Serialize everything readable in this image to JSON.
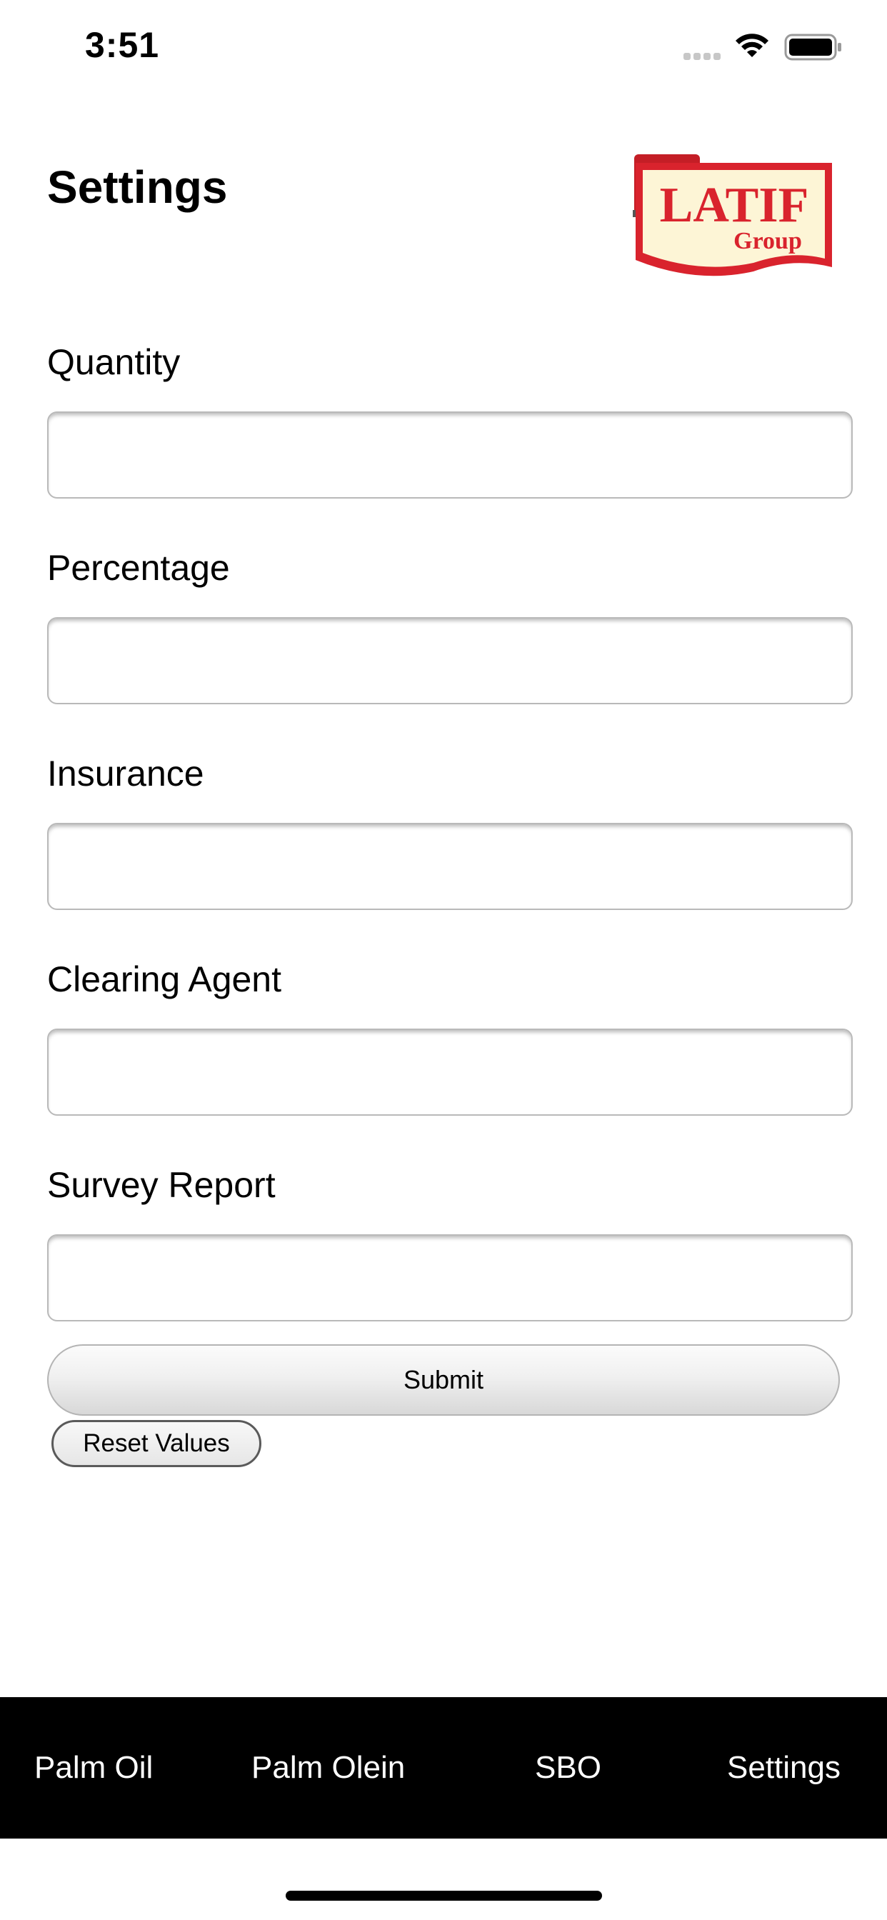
{
  "status_bar": {
    "time": "3:51"
  },
  "header": {
    "title": "Settings",
    "logo": {
      "main_text": "LATIF",
      "sub_text": "Group",
      "colors": {
        "red": "#d9232d",
        "cream": "#fdf5d6"
      }
    }
  },
  "form": {
    "fields": [
      {
        "label": "Quantity",
        "value": "",
        "placeholder": ""
      },
      {
        "label": "Percentage",
        "value": "",
        "placeholder": ""
      },
      {
        "label": "Insurance",
        "value": "",
        "placeholder": ""
      },
      {
        "label": "Clearing Agent",
        "value": "",
        "placeholder": ""
      },
      {
        "label": "Survey Report",
        "value": "",
        "placeholder": ""
      }
    ],
    "submit_label": "Submit",
    "reset_label": "Reset Values"
  },
  "tab_bar": {
    "items": [
      {
        "label": "Palm Oil"
      },
      {
        "label": "Palm Olein"
      },
      {
        "label": "SBO"
      },
      {
        "label": "Settings"
      }
    ]
  }
}
